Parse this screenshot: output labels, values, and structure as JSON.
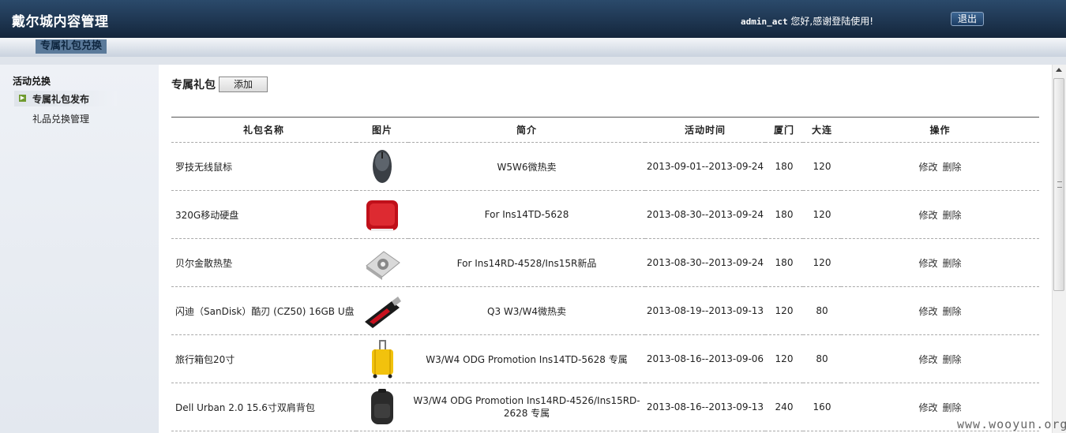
{
  "header": {
    "title": "戴尔城内容管理",
    "user": "admin_act",
    "welcome_text": " 您好,感谢登陆使用!",
    "logout_label": "退出"
  },
  "nav": {
    "active_tab": "专属礼包兑换"
  },
  "sidebar": {
    "section": "活动兑换",
    "items": [
      {
        "label": "专属礼包发布",
        "active": true
      },
      {
        "label": "礼品兑换管理",
        "active": false
      }
    ]
  },
  "content": {
    "title": "专属礼包",
    "add_label": "添加",
    "columns": [
      "礼包名称",
      "图片",
      "简介",
      "活动时间",
      "厦门",
      "大连",
      "操作"
    ],
    "edit_label": "修改",
    "delete_label": "删除",
    "rows": [
      {
        "name": "罗技无线鼠标",
        "image": "mouse-image",
        "desc": "W5W6微热卖",
        "period": "2013-09-01--2013-09-24",
        "xiamen": "180",
        "dalian": "120"
      },
      {
        "name": "320G移动硬盘",
        "image": "hard-drive-image",
        "desc": "For Ins14TD-5628",
        "period": "2013-08-30--2013-09-24",
        "xiamen": "180",
        "dalian": "120"
      },
      {
        "name": "贝尔金散热垫",
        "image": "cooling-pad-image",
        "desc": "For Ins14RD-4528/Ins15R新品",
        "period": "2013-08-30--2013-09-24",
        "xiamen": "180",
        "dalian": "120"
      },
      {
        "name": "闪迪（SanDisk）酷刃 (CZ50) 16GB U盘",
        "image": "usb-drive-image",
        "desc": "Q3 W3/W4微热卖",
        "period": "2013-08-19--2013-09-13",
        "xiamen": "120",
        "dalian": "80"
      },
      {
        "name": "旅行箱包20寸",
        "image": "suitcase-image",
        "desc": "W3/W4 ODG Promotion Ins14TD-5628 专属",
        "period": "2013-08-16--2013-09-06",
        "xiamen": "120",
        "dalian": "80"
      },
      {
        "name": "Dell Urban 2.0 15.6寸双肩背包",
        "image": "backpack-image",
        "desc": "W3/W4 ODG Promotion Ins14RD-4526/Ins15RD-2628 专属",
        "period": "2013-08-16--2013-09-13",
        "xiamen": "240",
        "dalian": "160"
      }
    ]
  },
  "watermark": "www.wooyun.org"
}
